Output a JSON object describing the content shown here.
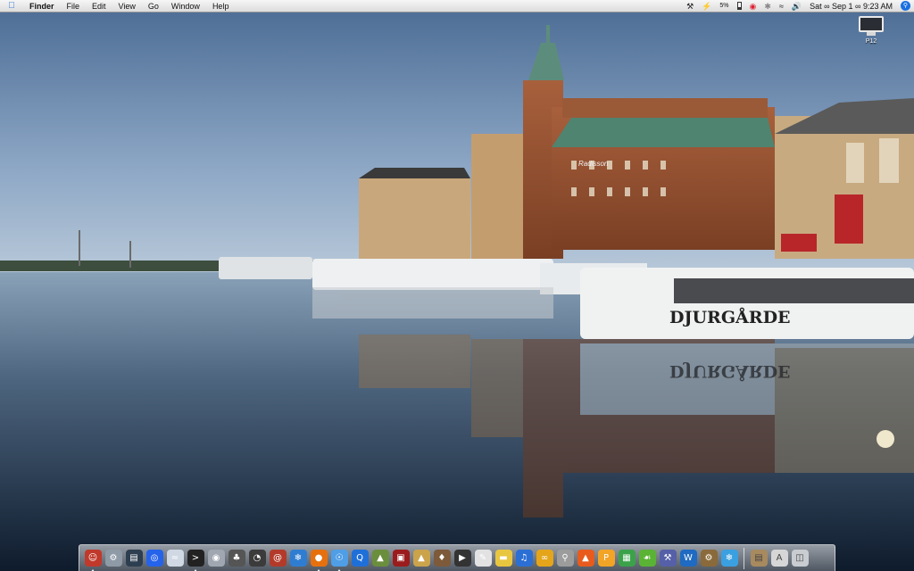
{
  "menubar": {
    "apple_icon": "apple-icon",
    "app_name": "Finder",
    "menus": [
      "File",
      "Edit",
      "View",
      "Go",
      "Window",
      "Help"
    ],
    "battery_percent": "5%",
    "clock": "Sat ∞ Sep 1 ∞ 9:23 AM"
  },
  "desktop": {
    "icons": [
      {
        "label": "P12",
        "icon": "imac-icon"
      }
    ],
    "wallpaper": {
      "boat_name": "DJURGÅRDE",
      "hotel_sign": "Radisson"
    }
  },
  "dock": {
    "apps": [
      {
        "name": "finder",
        "color": "#c0392b",
        "running": true
      },
      {
        "name": "system-prefs",
        "color": "#8e9aa6",
        "running": false
      },
      {
        "name": "activity-monitor",
        "color": "#2d3e50",
        "running": false
      },
      {
        "name": "network-utility",
        "color": "#2563eb",
        "running": false
      },
      {
        "name": "airport",
        "color": "#cfd8e3",
        "running": false
      },
      {
        "name": "terminal",
        "color": "#222222",
        "running": true
      },
      {
        "name": "disk-utility",
        "color": "#a0a7b0",
        "running": false
      },
      {
        "name": "stethoscope",
        "color": "#555555",
        "running": false
      },
      {
        "name": "dashboard",
        "color": "#3b3b3b",
        "running": false
      },
      {
        "name": "address-book",
        "color": "#b33a2a",
        "running": false
      },
      {
        "name": "safari",
        "color": "#2f7dd1",
        "running": false
      },
      {
        "name": "firefox",
        "color": "#e6700e",
        "running": true
      },
      {
        "name": "camino",
        "color": "#4f9ee6",
        "running": true
      },
      {
        "name": "quicktime",
        "color": "#1f6fd8",
        "running": false
      },
      {
        "name": "iphoto",
        "color": "#6b8e3d",
        "running": false
      },
      {
        "name": "photo-booth",
        "color": "#9b1c1c",
        "running": false
      },
      {
        "name": "cyberduck",
        "color": "#caa34b",
        "running": false
      },
      {
        "name": "transmission",
        "color": "#7d5a3a",
        "running": false
      },
      {
        "name": "imovie",
        "color": "#333333",
        "running": false
      },
      {
        "name": "textedit",
        "color": "#e2e2e2",
        "running": false
      },
      {
        "name": "stickies",
        "color": "#e8c640",
        "running": false
      },
      {
        "name": "itunes",
        "color": "#2b6fd4",
        "running": false
      },
      {
        "name": "adium",
        "color": "#e4a51b",
        "running": false
      },
      {
        "name": "preview",
        "color": "#9c9c9c",
        "running": false
      },
      {
        "name": "grapher",
        "color": "#e85b1c",
        "running": false
      },
      {
        "name": "pages",
        "color": "#f2a427",
        "running": false
      },
      {
        "name": "numbers",
        "color": "#3ba24a",
        "running": false
      },
      {
        "name": "smultron",
        "color": "#5ab334",
        "running": false
      },
      {
        "name": "xcode",
        "color": "#5560a8",
        "running": false
      },
      {
        "name": "word",
        "color": "#1f6ac2",
        "running": false
      },
      {
        "name": "automator",
        "color": "#8a6a3a",
        "running": false
      },
      {
        "name": "snow-icon",
        "color": "#3aa0e0",
        "running": false
      }
    ],
    "stacks": [
      {
        "name": "documents-stack",
        "color": "#a88a5f"
      },
      {
        "name": "applications-stack",
        "color": "#d6d6d6"
      },
      {
        "name": "trash",
        "color": "#c9ccd0"
      }
    ]
  }
}
